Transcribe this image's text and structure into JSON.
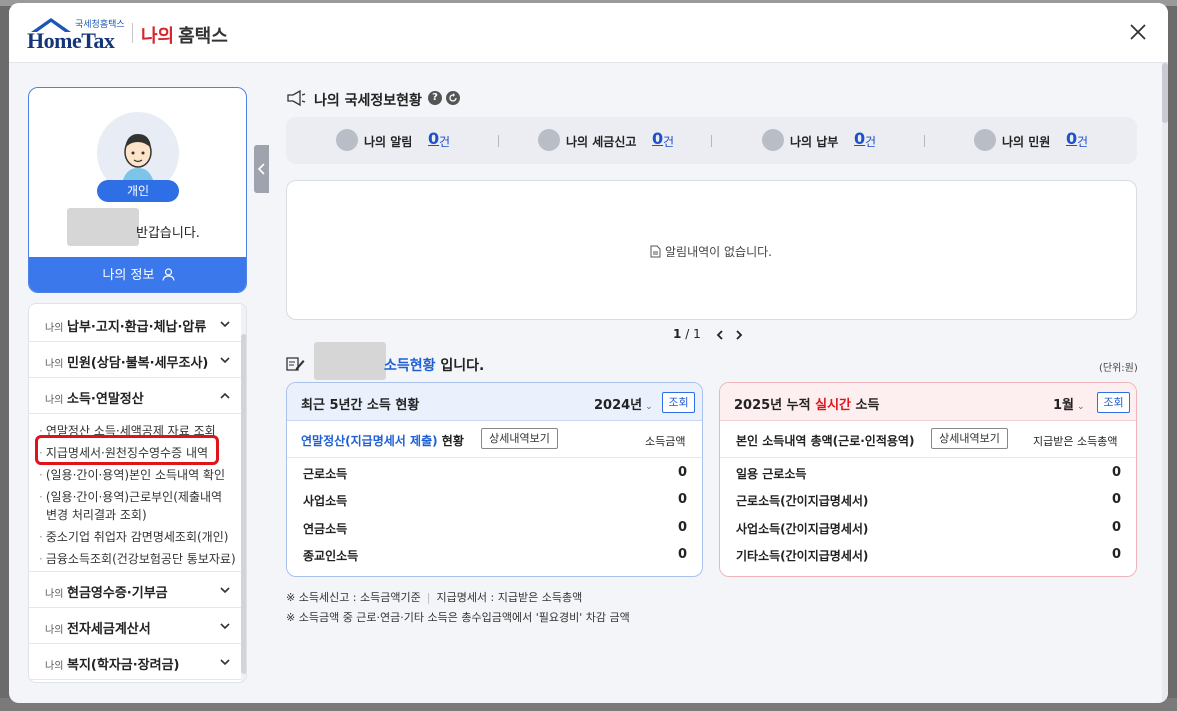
{
  "header": {
    "logo_small": "국세청홈택스",
    "logo_main": "HomeTax",
    "title_red": "나의",
    "title_dark": "홈택스"
  },
  "profile": {
    "badge": "개인",
    "greeting": "반갑습니다.",
    "my_info_label": "나의 정보"
  },
  "menu": {
    "items": [
      {
        "pre": "나의",
        "label": "납부·고지·환급·체납·압류"
      },
      {
        "pre": "나의",
        "label": "민원(상담·불복·세무조사)"
      },
      {
        "pre": "나의",
        "label": "소득·연말정산"
      },
      {
        "pre": "나의",
        "label": "현금영수증·기부금"
      },
      {
        "pre": "나의",
        "label": "전자세금계산서"
      },
      {
        "pre": "나의",
        "label": "복지(학자금·장려금)"
      }
    ],
    "sub_items": [
      "연말정산 소득·세액공제 자료 조회",
      "지급명세서·원천징수영수증 내역",
      "(일용·간이·용역)본인 소득내역 확인",
      "(일용·간이·용역)근로부인(제출내역",
      "변경 처리결과 조회)",
      "중소기업 취업자 감면명세조회(개인)",
      "금융소득조회(건강보험공단 통보자료)"
    ]
  },
  "status": {
    "title": "나의 국세정보현황",
    "help": "?",
    "items": [
      {
        "label": "나의 알림",
        "count": "0",
        "unit": "건"
      },
      {
        "label": "나의 세금신고",
        "count": "0",
        "unit": "건"
      },
      {
        "label": "나의 납부",
        "count": "0",
        "unit": "건"
      },
      {
        "label": "나의 민원",
        "count": "0",
        "unit": "건"
      }
    ],
    "empty_message": "알림내역이 없습니다.",
    "pager_current": "1",
    "pager_sep": "/",
    "pager_total": "1"
  },
  "income": {
    "title_blue": "소득현황",
    "title_rest": "입니다.",
    "unit_note": "(단위:원)",
    "left": {
      "title": "최근 5년간 소득 현황",
      "year": "2024년",
      "lookup": "조회",
      "sub_blue": "연말정산(지급명세서 제출)",
      "sub_rest": "현황",
      "detail": "상세내역보기",
      "col_label": "소득금액",
      "rows": [
        {
          "label": "근로소득",
          "value": "0"
        },
        {
          "label": "사업소득",
          "value": "0"
        },
        {
          "label": "연금소득",
          "value": "0"
        },
        {
          "label": "종교인소득",
          "value": "0"
        }
      ]
    },
    "right": {
      "title_pre": "2025년 누적",
      "title_red": "실시간",
      "title_post": "소득",
      "month": "1월",
      "lookup": "조회",
      "sub": "본인 소득내역 총액(근로·인적용역)",
      "detail": "상세내역보기",
      "col_label": "지급받은 소득총액",
      "rows": [
        {
          "label": "일용 근로소득",
          "value": "0"
        },
        {
          "label": "근로소득(간이지급명세서)",
          "value": "0"
        },
        {
          "label": "사업소득(간이지급명세서)",
          "value": "0"
        },
        {
          "label": "기타소득(간이지급명세서)",
          "value": "0"
        }
      ]
    },
    "footnotes": {
      "line1_a": "※ 소득세신고 : 소득금액기준",
      "line1_b": "지급명세서 : 지급받은 소득총액",
      "line2": "※ 소득금액 중 근로·연금·기타 소득은 총수입금액에서 '필요경비' 차감 금액"
    }
  },
  "colors": {
    "accent_blue": "#3a78ec",
    "highlight_red": "#e0121b",
    "brand_navy": "#15357a"
  }
}
